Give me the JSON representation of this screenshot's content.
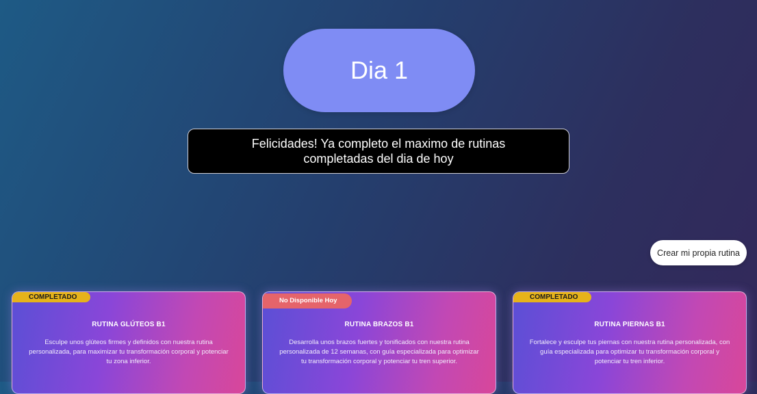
{
  "day": {
    "title": "Dia 1"
  },
  "message": {
    "line1": "Felicidades! Ya completo el maximo de rutinas",
    "line2": "completadas del dia de hoy"
  },
  "create_button": {
    "label": "Crear mi propia rutina"
  },
  "cards": [
    {
      "badge": "COMPLETADO",
      "title": "RUTINA GLÚTEOS B1",
      "description": "Esculpe unos glúteos firmes y definidos con nuestra rutina personalizada, para maximizar tu transformación corporal y potenciar tu zona inferior."
    },
    {
      "badge": "No Disponible Hoy",
      "title": "RUTINA BRAZOS B1",
      "description": "Desarrolla unos brazos fuertes y tonificados con nuestra rutina personalizada de 12 semanas, con guía especializada para optimizar tu transformación corporal y potenciar tu tren superior."
    },
    {
      "badge": "COMPLETADO",
      "title": "RUTINA PIERNAS B1",
      "description": "Fortalece y esculpe tus piernas con nuestra rutina personalizada, con guía especializada para optimizar tu transformación corporal y potenciar tu tren inferior."
    }
  ],
  "colors": {
    "pill": "#7f8cf4",
    "badge_completed": "#e6b31a",
    "badge_unavailable": "#e5646a"
  }
}
